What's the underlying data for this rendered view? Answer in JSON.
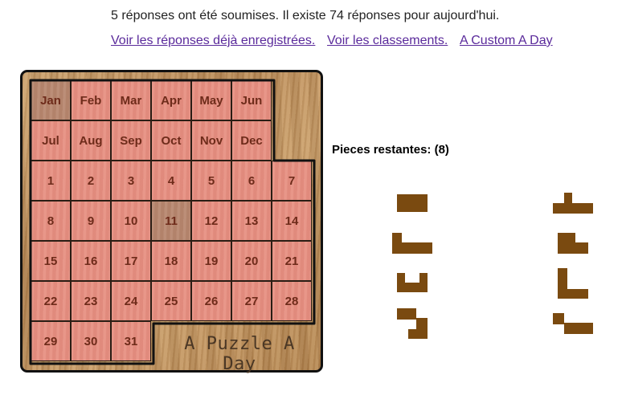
{
  "header": {
    "info_text": "5 réponses ont été soumises. Il existe 74 réponses pour aujourd'hui.",
    "links": [
      {
        "label": "Voir les réponses déjà enregistrées."
      },
      {
        "label": "Voir les classements."
      },
      {
        "label": "A Custom A Day"
      }
    ]
  },
  "board": {
    "brand_text": "A Puzzle A Day",
    "selected_month": "Jan",
    "selected_day": "11",
    "rows": [
      [
        "Jan",
        "Feb",
        "Mar",
        "Apr",
        "May",
        "Jun"
      ],
      [
        "Jul",
        "Aug",
        "Sep",
        "Oct",
        "Nov",
        "Dec"
      ],
      [
        "1",
        "2",
        "3",
        "4",
        "5",
        "6",
        "7"
      ],
      [
        "8",
        "9",
        "10",
        "11",
        "12",
        "13",
        "14"
      ],
      [
        "15",
        "16",
        "17",
        "18",
        "19",
        "20",
        "21"
      ],
      [
        "22",
        "23",
        "24",
        "25",
        "26",
        "27",
        "28"
      ],
      [
        "29",
        "30",
        "31"
      ]
    ]
  },
  "pieces_panel": {
    "title": "Pieces restantes: (8)",
    "piece_color": "#7a4a10",
    "pieces": [
      {
        "name": "piece-rectangle-3x2"
      },
      {
        "name": "piece-t-shape"
      },
      {
        "name": "piece-l-long"
      },
      {
        "name": "piece-p-shape"
      },
      {
        "name": "piece-u-shape"
      },
      {
        "name": "piece-l-corner"
      },
      {
        "name": "piece-s-shape"
      },
      {
        "name": "piece-z-shape"
      }
    ]
  },
  "colors": {
    "cell": "#e79183",
    "cell_target": "#b98a72",
    "cell_text": "#6e2b1a",
    "link": "#5a2a9b",
    "wood": "#c49a66"
  }
}
